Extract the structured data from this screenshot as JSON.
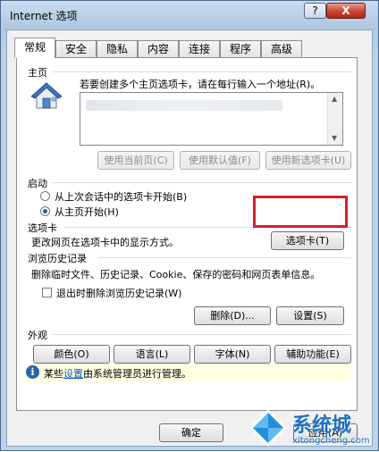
{
  "window": {
    "title": "Internet 选项",
    "help_label": "?",
    "close_label": "X"
  },
  "tabs": [
    {
      "label": "常规"
    },
    {
      "label": "安全"
    },
    {
      "label": "隐私"
    },
    {
      "label": "内容"
    },
    {
      "label": "连接"
    },
    {
      "label": "程序"
    },
    {
      "label": "高级"
    }
  ],
  "home": {
    "title": "主页",
    "desc": "若要创建多个主页选项卡，请在每行输入一个地址(R)。",
    "btn_current": "使用当前页(C)",
    "btn_default": "使用默认值(F)",
    "btn_newtab": "使用新选项卡(U)"
  },
  "startup": {
    "title": "启动",
    "option_last": "从上次会话中的选项卡开始(B)",
    "option_home": "从主页开始(H)"
  },
  "tabsection": {
    "title": "选项卡",
    "desc": "更改网页在选项卡中的显示方式。",
    "btn": "选项卡(T)"
  },
  "history": {
    "title": "浏览历史记录",
    "desc": "删除临时文件、历史记录、Cookie、保存的密码和网页表单信息。",
    "check_label": "退出时删除浏览历史记录(W)",
    "btn_delete": "删除(D)...",
    "btn_settings": "设置(S)"
  },
  "appearance": {
    "title": "外观",
    "btn_colors": "颜色(O)",
    "btn_languages": "语言(L)",
    "btn_fonts": "字体(N)",
    "btn_accessibility": "辅助功能(E)"
  },
  "info": {
    "prefix": "某些",
    "link": "设置",
    "suffix": "由系统管理员进行管理。"
  },
  "footer": {
    "ok": "确定",
    "apply": "应用(A)"
  },
  "watermark": {
    "text_cn": "系统城",
    "text_url": "xitongcheng.com"
  }
}
